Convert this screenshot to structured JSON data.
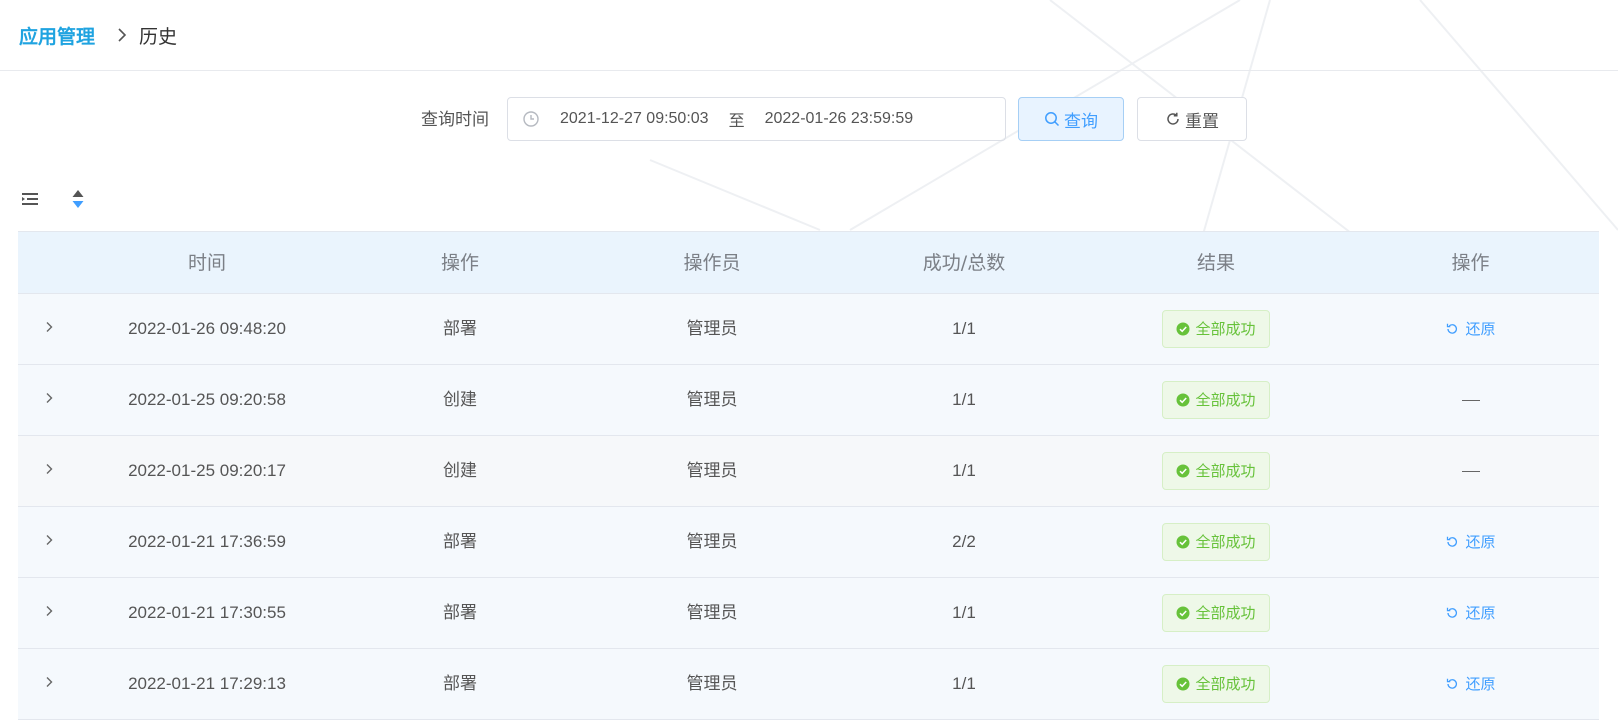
{
  "breadcrumb": {
    "root": "应用管理",
    "current": "历史"
  },
  "search": {
    "label": "查询时间",
    "start": "2021-12-27 09:50:03",
    "separator": "至",
    "end": "2022-01-26 23:59:59",
    "query_label": "查询",
    "reset_label": "重置"
  },
  "table": {
    "columns": [
      "时间",
      "操作",
      "操作员",
      "成功/总数",
      "结果",
      "操作"
    ],
    "rows": [
      {
        "time": "2022-01-26 09:48:20",
        "operation": "部署",
        "operator": "管理员",
        "ratio": "1/1",
        "result": "全部成功",
        "action": "还原"
      },
      {
        "time": "2022-01-25 09:20:58",
        "operation": "创建",
        "operator": "管理员",
        "ratio": "1/1",
        "result": "全部成功",
        "action": ""
      },
      {
        "time": "2022-01-25 09:20:17",
        "operation": "创建",
        "operator": "管理员",
        "ratio": "1/1",
        "result": "全部成功",
        "action": ""
      },
      {
        "time": "2022-01-21 17:36:59",
        "operation": "部署",
        "operator": "管理员",
        "ratio": "2/2",
        "result": "全部成功",
        "action": "还原"
      },
      {
        "time": "2022-01-21 17:30:55",
        "operation": "部署",
        "operator": "管理员",
        "ratio": "1/1",
        "result": "全部成功",
        "action": "还原"
      },
      {
        "time": "2022-01-21 17:29:13",
        "operation": "部署",
        "operator": "管理员",
        "ratio": "1/1",
        "result": "全部成功",
        "action": "还原"
      }
    ]
  },
  "colors": {
    "brand": "#1fa3e0",
    "primary": "#409eff",
    "success": "#67c23a",
    "header_bg": "#eaf4fd"
  },
  "icons": {
    "breadcrumb_separator": "chevron-right-icon",
    "date_picker": "clock-icon",
    "query": "search-icon",
    "reset": "refresh-icon",
    "toolbar_list": "list-collapse-icon",
    "toolbar_sort": "sort-icon",
    "row_expand": "chevron-right-icon",
    "result": "check-circle-icon",
    "restore": "undo-icon"
  }
}
